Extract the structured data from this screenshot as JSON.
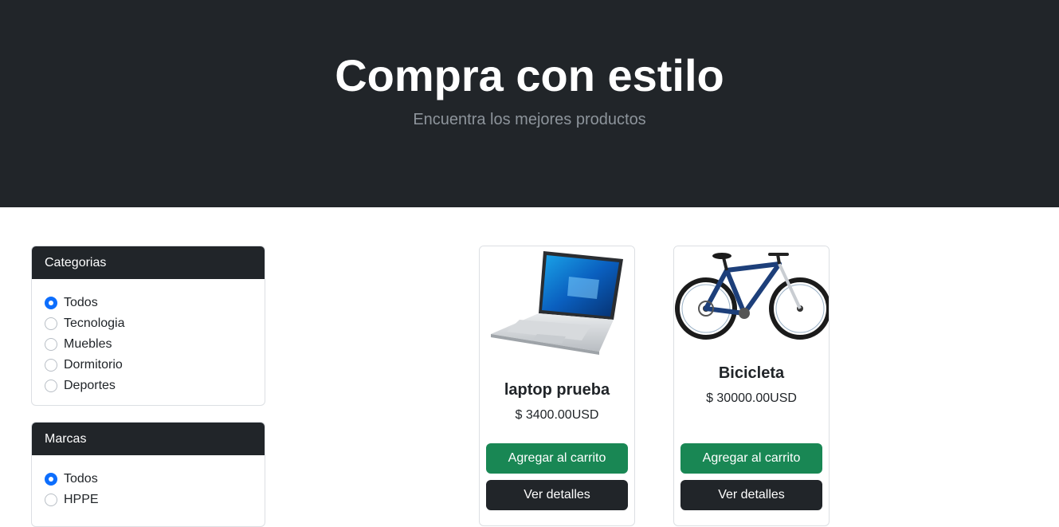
{
  "hero": {
    "title": "Compra con estilo",
    "subtitle": "Encuentra los mejores productos"
  },
  "filters": {
    "categories": {
      "title": "Categorias",
      "options": [
        "Todos",
        "Tecnologia",
        "Muebles",
        "Dormitorio",
        "Deportes"
      ],
      "selected": "Todos"
    },
    "brands": {
      "title": "Marcas",
      "options": [
        "Todos",
        "HPPE"
      ],
      "selected": "Todos"
    }
  },
  "products": [
    {
      "name": "laptop prueba",
      "price": "$ 3400.00USD",
      "image_icon": "laptop-image",
      "add_to_cart": "Agregar al carrito",
      "details": "Ver detalles"
    },
    {
      "name": "Bicicleta",
      "price": "$ 30000.00USD",
      "image_icon": "bicycle-image",
      "add_to_cart": "Agregar al carrito",
      "details": "Ver detalles"
    }
  ],
  "colors": {
    "hero_bg": "#212529",
    "primary": "#0d6efd",
    "success": "#198754",
    "dark": "#212529"
  }
}
